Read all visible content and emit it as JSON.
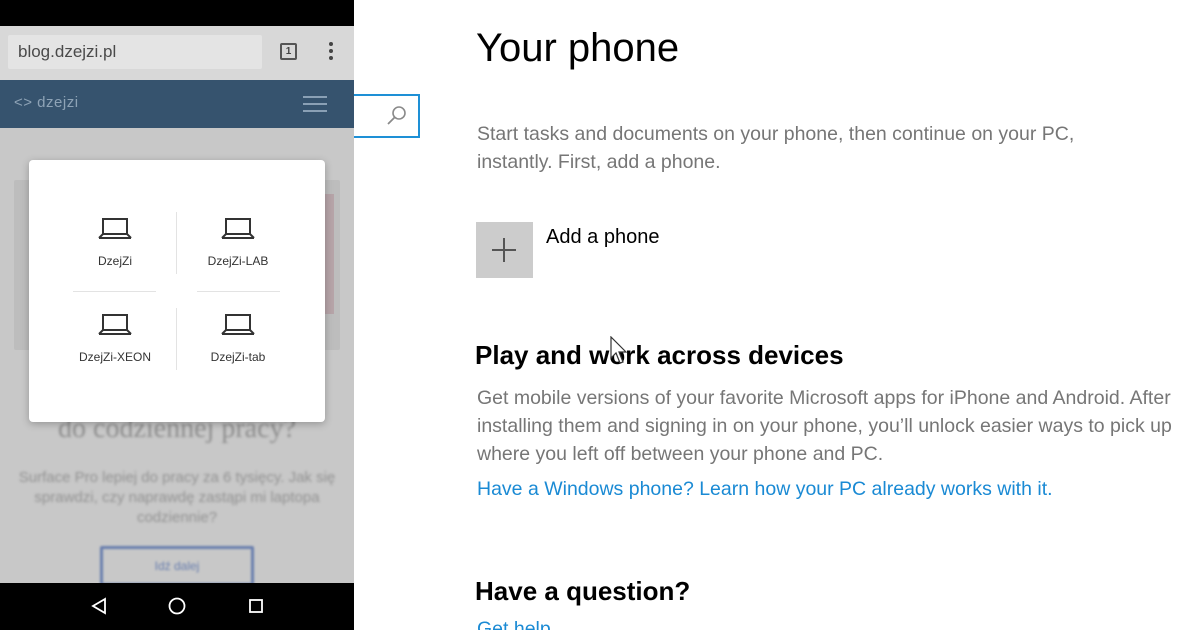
{
  "phone": {
    "browser": {
      "url": "blog.dzejzi.pl",
      "tab_count": "1"
    },
    "site": {
      "logo": "<> dzejzi"
    },
    "background": {
      "heading": "do codziennej pracy?",
      "paragraph": "Surface Pro lepiej do pracy za 6 tysięcy. Jak się sprawdzi, czy naprawdę zastąpi mi laptopa codziennie?",
      "button": "Idź dalej"
    },
    "device_dialog": {
      "devices": [
        {
          "name": "DzejZi",
          "icon": "laptop-icon"
        },
        {
          "name": "DzejZi-LAB",
          "icon": "laptop-icon"
        },
        {
          "name": "DzejZi-XEON",
          "icon": "laptop-icon"
        },
        {
          "name": "DzejZi-tab",
          "icon": "laptop-icon"
        }
      ]
    },
    "nav": {
      "back_icon": "triangle-back-icon",
      "home_icon": "circle-home-icon",
      "recent_icon": "square-recents-icon"
    }
  },
  "settings": {
    "search": {
      "icon": "search-icon",
      "accent": "#1e90d6"
    },
    "title": "Your phone",
    "intro": "Start tasks and documents on your phone, then continue on your PC, instantly. First, add a phone.",
    "add_phone_label": "Add a phone",
    "play_heading": "Play and work across devices",
    "play_text": "Get mobile versions of your favorite Microsoft apps for iPhone and Android. After installing them and signing in on your phone, you’ll unlock easier ways to pick up where you left off between your phone and PC.",
    "windows_phone_link": "Have a Windows phone? Learn how your PC already works with it.",
    "question_heading": "Have a question?",
    "help_link": "Get help",
    "link_color": "#1a8ad4"
  }
}
